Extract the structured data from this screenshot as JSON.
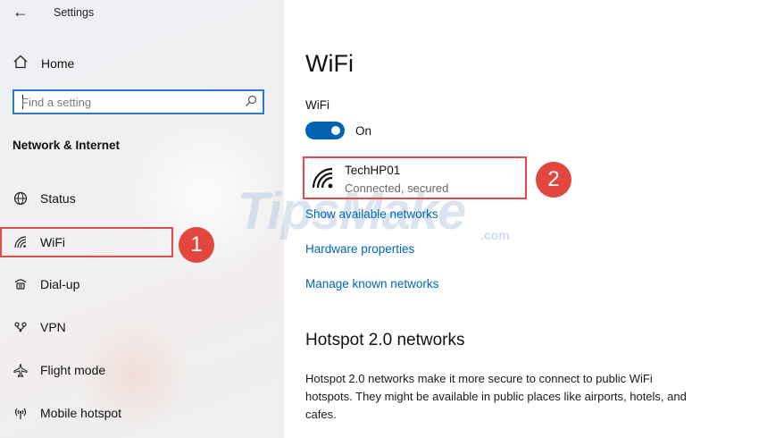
{
  "app": {
    "title": "Settings",
    "back_icon": "back-arrow-icon"
  },
  "sidebar": {
    "home_label": "Home",
    "search": {
      "placeholder": "Find a setting",
      "icon": "search-icon"
    },
    "section_title": "Network & Internet",
    "items": [
      {
        "label": "Status",
        "icon": "globe-icon"
      },
      {
        "label": "WiFi",
        "icon": "wifi-icon",
        "selected": true
      },
      {
        "label": "Dial-up",
        "icon": "dialup-icon"
      },
      {
        "label": "VPN",
        "icon": "vpn-icon"
      },
      {
        "label": "Flight mode",
        "icon": "airplane-icon"
      },
      {
        "label": "Mobile hotspot",
        "icon": "hotspot-icon"
      }
    ]
  },
  "main": {
    "title": "WiFi",
    "wifi_label": "WiFi",
    "toggle": {
      "state": "On",
      "on": true
    },
    "network": {
      "name": "TechHP01",
      "status": "Connected, secured",
      "icon": "wifi-signal-icon"
    },
    "links": {
      "show_networks": "Show available networks",
      "hardware": "Hardware properties",
      "manage": "Manage known networks"
    },
    "hotspot": {
      "title": "Hotspot 2.0 networks",
      "description": "Hotspot 2.0 networks make it more secure to connect to public WiFi hotspots. They might be available in public places like airports, hotels, and cafes."
    }
  },
  "annotations": {
    "badge1": "1",
    "badge2": "2"
  },
  "watermark": {
    "text": "TipsMake",
    "suffix": ".com"
  },
  "colors": {
    "accent": "#0063b1",
    "link": "#0067b8",
    "highlight": "#e24b4b",
    "badge": "#e2463e"
  }
}
